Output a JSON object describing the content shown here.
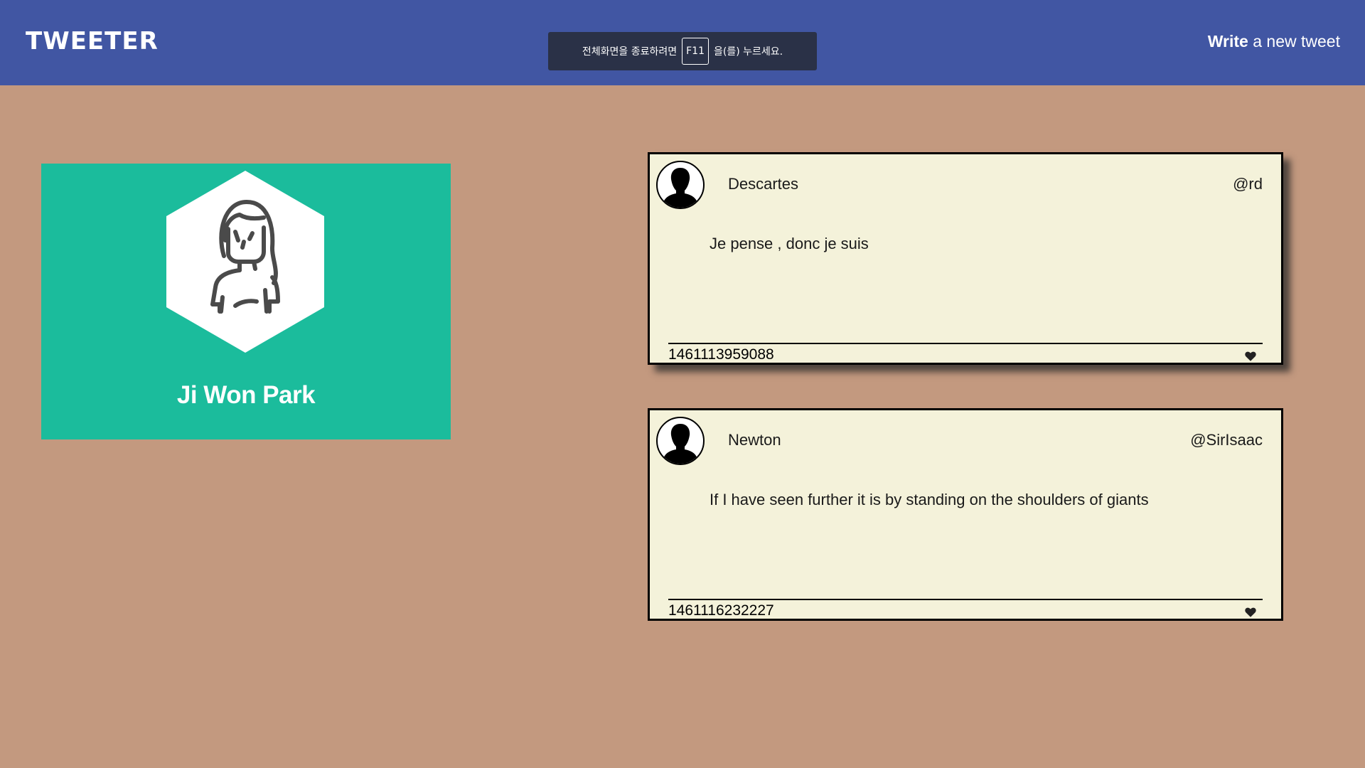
{
  "header": {
    "logo": "TWEETER",
    "write_bold": "Write",
    "write_rest": " a new tweet"
  },
  "fullscreen_notice": {
    "before": "전체화면을 종료하려면",
    "key": "F11",
    "after": "을(를) 누르세요."
  },
  "profile": {
    "name": "Ji Won Park",
    "avatar_icon": "woman-avatar-icon"
  },
  "tweets": [
    {
      "author": "Descartes",
      "handle": "@rd",
      "text": "Je pense , donc je suis",
      "timestamp": "1461113959088",
      "like_icon": "heart-icon"
    },
    {
      "author": "Newton",
      "handle": "@SirIsaac",
      "text": "If I have seen further it is by standing on the shoulders of giants",
      "timestamp": "1461116232227",
      "like_icon": "heart-icon"
    }
  ],
  "colors": {
    "header_bg": "#4156a3",
    "page_bg": "#c3997f",
    "profile_bg": "#1bbc9c",
    "tweet_bg": "#f4f2da"
  }
}
